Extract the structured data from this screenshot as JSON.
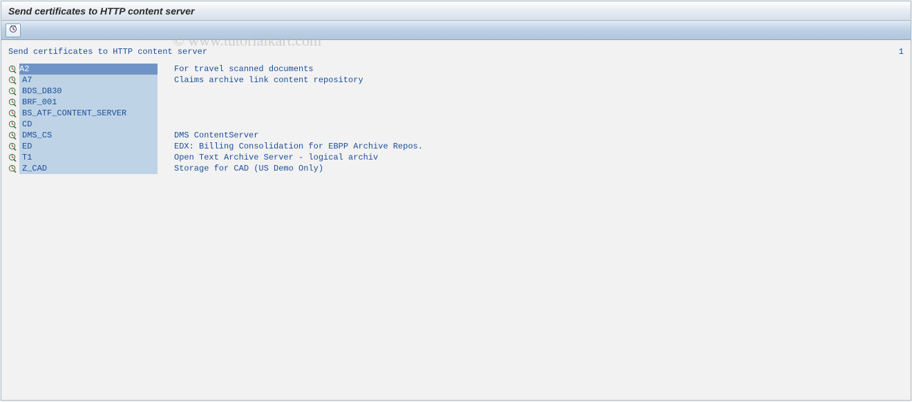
{
  "window": {
    "title": "Send certificates to HTTP content server"
  },
  "watermark": "© www.tutorialkart.com",
  "status": {
    "left": "Send certificates to HTTP content server",
    "right": "1"
  },
  "rows": [
    {
      "code": "A2",
      "desc": "For travel scanned documents",
      "selected": true
    },
    {
      "code": "A7",
      "desc": "Claims archive link content repository",
      "selected": false
    },
    {
      "code": "BDS_DB30",
      "desc": "",
      "selected": false
    },
    {
      "code": "BRF_001",
      "desc": "",
      "selected": false
    },
    {
      "code": "BS_ATF_CONTENT_SERVER",
      "desc": "",
      "selected": false
    },
    {
      "code": "CD",
      "desc": "",
      "selected": false
    },
    {
      "code": "DMS_CS",
      "desc": "DMS ContentServer",
      "selected": false
    },
    {
      "code": "ED",
      "desc": "EDX: Billing Consolidation for EBPP Archive Repos.",
      "selected": false
    },
    {
      "code": "T1",
      "desc": "Open Text Archive Server - logical archiv",
      "selected": false
    },
    {
      "code": "Z_CAD",
      "desc": "Storage for CAD (US Demo Only)",
      "selected": false
    }
  ]
}
